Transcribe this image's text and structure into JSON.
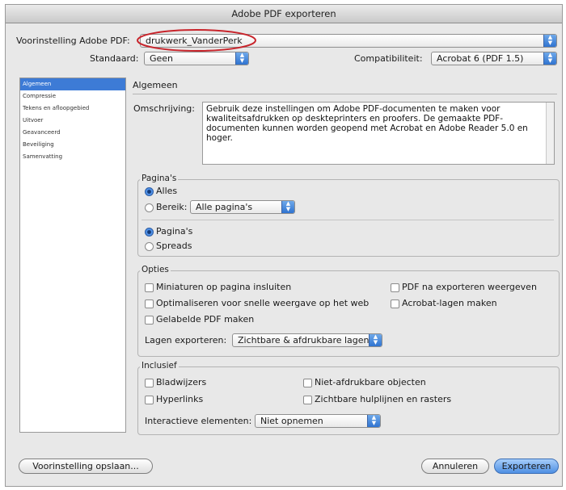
{
  "window": {
    "title": "Adobe PDF exporteren"
  },
  "top": {
    "preset_label": "Voorinstelling Adobe PDF:",
    "preset_value": "drukwerk_VanderPerk",
    "standard_label": "Standaard:",
    "standard_value": "Geen",
    "compat_label": "Compatibiliteit:",
    "compat_value": "Acrobat 6 (PDF 1.5)"
  },
  "sidebar": {
    "items": [
      {
        "label": "Algemeen",
        "selected": true
      },
      {
        "label": "Compressie"
      },
      {
        "label": "Tekens en afloopgebied"
      },
      {
        "label": "Uitvoer"
      },
      {
        "label": "Geavanceerd"
      },
      {
        "label": "Beveiliging"
      },
      {
        "label": "Samenvatting"
      }
    ]
  },
  "main": {
    "section_title": "Algemeen",
    "description_label": "Omschrijving:",
    "description_text": "Gebruik deze instellingen om Adobe PDF-documenten te maken voor kwaliteitsafdrukken op deskteprinters en proofers. De gemaakte PDF-documenten kunnen worden geopend met Acrobat en Adobe Reader 5.0 en hoger.",
    "pages": {
      "title": "Pagina's",
      "all_label": "Alles",
      "range_label": "Bereik:",
      "range_value": "Alle pagina's",
      "pages_label": "Pagina's",
      "spreads_label": "Spreads"
    },
    "options": {
      "title": "Opties",
      "embed_thumbnails": "Miniaturen op pagina insluiten",
      "optimize_web": "Optimaliseren voor snelle weergave op het web",
      "tagged_pdf": "Gelabelde PDF maken",
      "view_after_export": "PDF na exporteren weergeven",
      "acrobat_layers": "Acrobat-lagen maken",
      "export_layers_label": "Lagen exporteren:",
      "export_layers_value": "Zichtbare & afdrukbare lagen"
    },
    "include": {
      "title": "Inclusief",
      "bookmarks": "Bladwijzers",
      "hyperlinks": "Hyperlinks",
      "nonprinting": "Niet-afdrukbare objecten",
      "guides": "Zichtbare hulplijnen en rasters",
      "interactive_label": "Interactieve elementen:",
      "interactive_value": "Niet opnemen"
    }
  },
  "buttons": {
    "save_preset": "Voorinstelling opslaan...",
    "cancel": "Annuleren",
    "export": "Exporteren"
  },
  "colors": {
    "accent": "#3d7bd6",
    "highlight_ring": "#c8242b"
  }
}
